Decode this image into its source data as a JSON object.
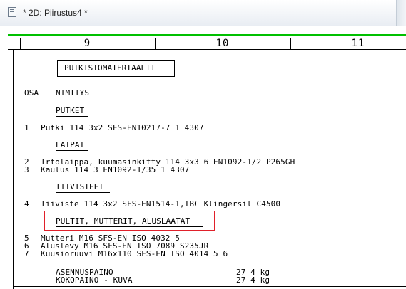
{
  "window": {
    "title": "* 2D: Piirustus4 *"
  },
  "ruler": {
    "columns": [
      "9",
      "10",
      "11"
    ]
  },
  "parts_list": {
    "heading": "PUTKISTOMATERIAALIT",
    "col_osa": "OSA",
    "col_nimitys": "NIMITYS",
    "sections": {
      "putket": "PUTKET",
      "laipat": "LAIPAT",
      "tiivisteet": "TIIVISTEET",
      "pultit": "PULTIT, MUTTERIT, ALUSLAATAT"
    },
    "items": [
      {
        "no": "1",
        "text": "Putki 114 3x2 SFS-EN10217-7 1 4307"
      },
      {
        "no": "2",
        "text": "Irtolaippa, kuumasinkitty 114 3x3 6 EN1092-1/2 P265GH"
      },
      {
        "no": "3",
        "text": "Kaulus 114 3 EN1092-1/35 1 4307"
      },
      {
        "no": "4",
        "text": "Tiiviste 114 3x2 SFS-EN1514-1,IBC Klingersil C4500"
      },
      {
        "no": "5",
        "text": "Mutteri M16 SFS-EN ISO 4032 5"
      },
      {
        "no": "6",
        "text": "Aluslevy M16 SFS-EN ISO 7089 S235JR"
      },
      {
        "no": "7",
        "text": "Kuusioruuvi M16x110 SFS-EN ISO 4014 5 6"
      }
    ],
    "totals": [
      {
        "label": "ASENNUSPAINO",
        "value": "27 4 kg"
      },
      {
        "label": "KOKOPAINO - KUVA",
        "value": "27 4 kg"
      }
    ]
  },
  "colors": {
    "highlight": "#e0202a",
    "grid_line": "#00c000"
  }
}
